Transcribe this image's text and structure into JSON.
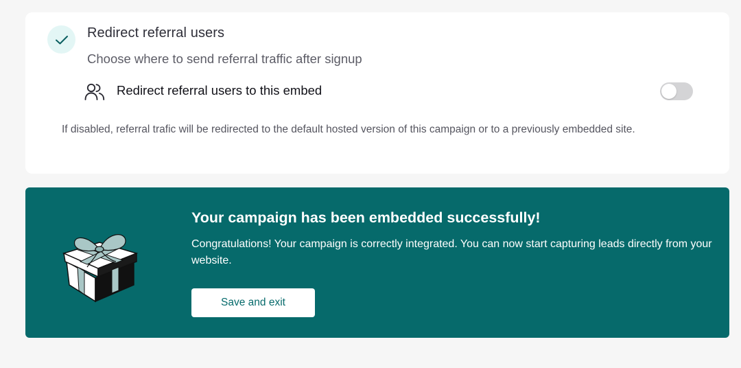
{
  "settings_card": {
    "title": "Redirect referral users",
    "subtitle": "Choose where to send referral traffic after signup",
    "option_label": "Redirect referral users to this embed",
    "option_enabled": false,
    "note": "If disabled, referral trafic will be redirected to the default hosted version of this campaign or to a previously embedded site.",
    "status_icon": "check-icon",
    "option_icon": "users-icon"
  },
  "success_banner": {
    "title": "Your campaign has been embedded successfully!",
    "message": "Congratulations! Your campaign is correctly integrated. You can now start capturing leads directly from your website.",
    "button_label": "Save and exit",
    "illustration": "gift-box-icon"
  },
  "colors": {
    "page_background": "#f6f6f6",
    "banner_background": "#066a6b",
    "check_circle": "#e3f6f5",
    "toggle_off": "#d4d4d6"
  }
}
